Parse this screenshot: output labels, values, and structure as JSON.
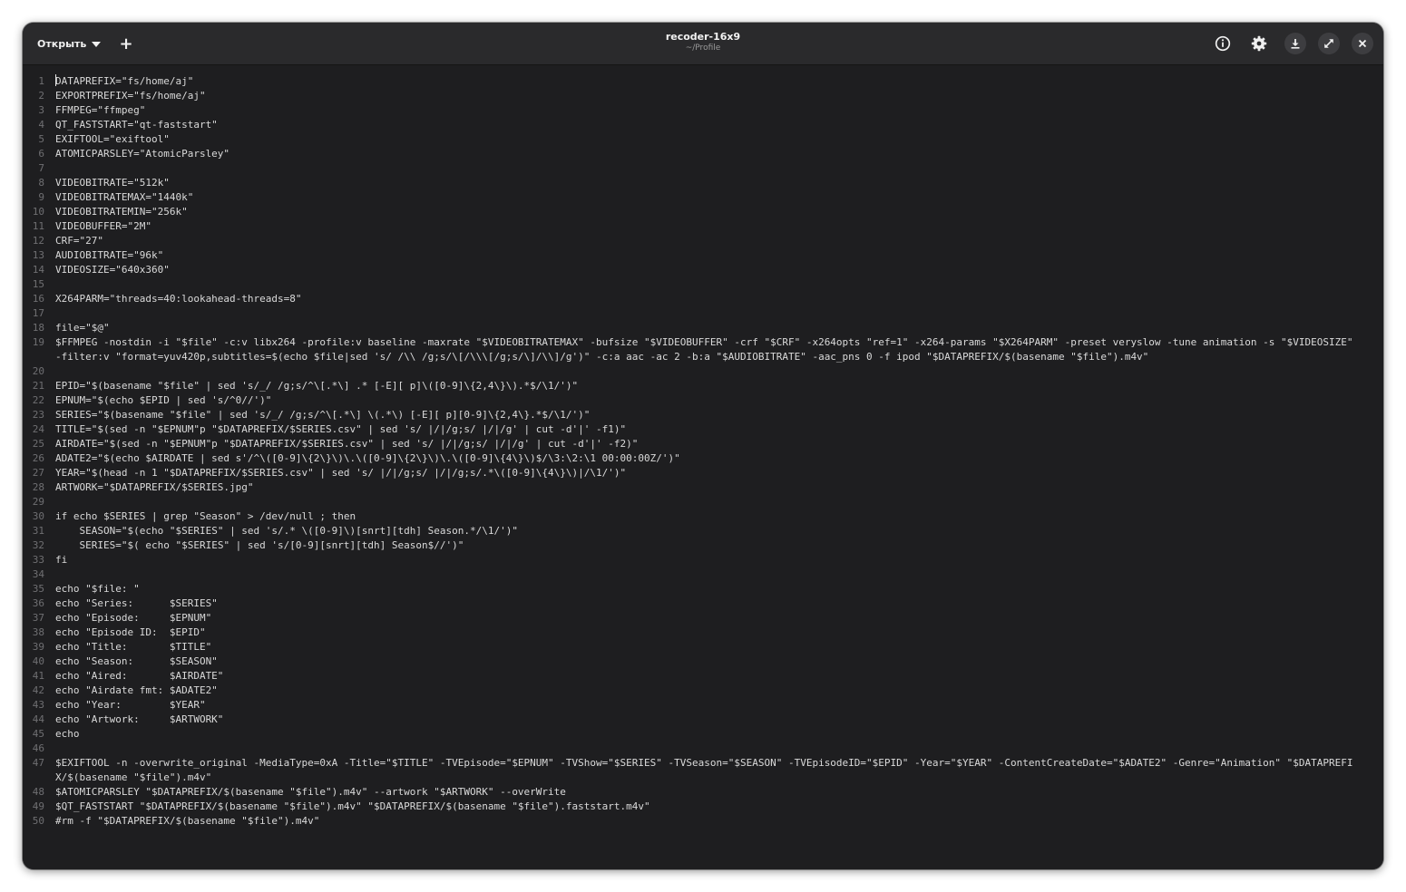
{
  "header": {
    "open_label": "Открыть",
    "new_tab_symbol": "+",
    "title": "recoder-16x9",
    "subtitle": "~/Profile",
    "icons": [
      "info-icon",
      "gear-icon",
      "download-icon",
      "fullscreen-icon",
      "close-icon"
    ]
  },
  "editor": {
    "lines": [
      "DATAPREFIX=\"fs/home/aj\"",
      "EXPORTPREFIX=\"fs/home/aj\"",
      "FFMPEG=\"ffmpeg\"",
      "QT_FASTSTART=\"qt-faststart\"",
      "EXIFTOOL=\"exiftool\"",
      "ATOMICPARSLEY=\"AtomicParsley\"",
      "",
      "VIDEOBITRATE=\"512k\"",
      "VIDEOBITRATEMAX=\"1440k\"",
      "VIDEOBITRATEMIN=\"256k\"",
      "VIDEOBUFFER=\"2M\"",
      "CRF=\"27\"",
      "AUDIOBITRATE=\"96k\"",
      "VIDEOSIZE=\"640x360\"",
      "",
      "X264PARM=\"threads=40:lookahead-threads=8\"",
      "",
      "file=\"$@\"",
      "$FFMPEG -nostdin -i \"$file\" -c:v libx264 -profile:v baseline -maxrate \"$VIDEOBITRATEMAX\" -bufsize \"$VIDEOBUFFER\" -crf \"$CRF\" -x264opts \"ref=1\" -x264-params \"$X264PARM\" -preset veryslow -tune animation -s \"$VIDEOSIZE\" -filter:v \"format=yuv420p,subtitles=$(echo $file|sed 's/ /\\\\ /g;s/\\[/\\\\\\[/g;s/\\]/\\\\]/g')\" -c:a aac -ac 2 -b:a \"$AUDIOBITRATE\" -aac_pns 0 -f ipod \"$DATAPREFIX/$(basename \"$file\").m4v\"",
      "",
      "EPID=\"$(basename \"$file\" | sed 's/_/ /g;s/^\\[.*\\] .* [-E][ p]\\([0-9]\\{2,4\\}\\).*$/\\1/')\"",
      "EPNUM=\"$(echo $EPID | sed 's/^0//')\"",
      "SERIES=\"$(basename \"$file\" | sed 's/_/ /g;s/^\\[.*\\] \\(.*\\) [-E][ p][0-9]\\{2,4\\}.*$/\\1/')\"",
      "TITLE=\"$(sed -n \"$EPNUM\"p \"$DATAPREFIX/$SERIES.csv\" | sed 's/ |/|/g;s/ |/|/g' | cut -d'|' -f1)\"",
      "AIRDATE=\"$(sed -n \"$EPNUM\"p \"$DATAPREFIX/$SERIES.csv\" | sed 's/ |/|/g;s/ |/|/g' | cut -d'|' -f2)\"",
      "ADATE2=\"$(echo $AIRDATE | sed s'/^\\([0-9]\\{2\\}\\)\\.\\([0-9]\\{2\\}\\)\\.\\([0-9]\\{4\\}\\)$/\\3:\\2:\\1 00:00:00Z/')\"",
      "YEAR=\"$(head -n 1 \"$DATAPREFIX/$SERIES.csv\" | sed 's/ |/|/g;s/ |/|/g;s/.*\\([0-9]\\{4\\}\\)|/\\1/')\"",
      "ARTWORK=\"$DATAPREFIX/$SERIES.jpg\"",
      "",
      "if echo $SERIES | grep \"Season\" > /dev/null ; then",
      "    SEASON=\"$(echo \"$SERIES\" | sed 's/.* \\([0-9]\\)[snrt][tdh] Season.*/\\1/')\"",
      "    SERIES=\"$( echo \"$SERIES\" | sed 's/[0-9][snrt][tdh] Season$//')\"",
      "fi",
      "",
      "echo \"$file: \"",
      "echo \"Series:      $SERIES\"",
      "echo \"Episode:     $EPNUM\"",
      "echo \"Episode ID:  $EPID\"",
      "echo \"Title:       $TITLE\"",
      "echo \"Season:      $SEASON\"",
      "echo \"Aired:       $AIRDATE\"",
      "echo \"Airdate fmt: $ADATE2\"",
      "echo \"Year:        $YEAR\"",
      "echo \"Artwork:     $ARTWORK\"",
      "echo",
      "",
      "$EXIFTOOL -n -overwrite_original -MediaType=0xA -Title=\"$TITLE\" -TVEpisode=\"$EPNUM\" -TVShow=\"$SERIES\" -TVSeason=\"$SEASON\" -TVEpisodeID=\"$EPID\" -Year=\"$YEAR\" -ContentCreateDate=\"$ADATE2\" -Genre=\"Animation\" \"$DATAPREFIX/$(basename \"$file\").m4v\"",
      "$ATOMICPARSLEY \"$DATAPREFIX/$(basename \"$file\").m4v\" --artwork \"$ARTWORK\" --overWrite",
      "$QT_FASTSTART \"$DATAPREFIX/$(basename \"$file\").m4v\" \"$DATAPREFIX/$(basename \"$file\").faststart.m4v\"",
      "#rm -f \"$DATAPREFIX/$(basename \"$file\").m4v\""
    ]
  }
}
